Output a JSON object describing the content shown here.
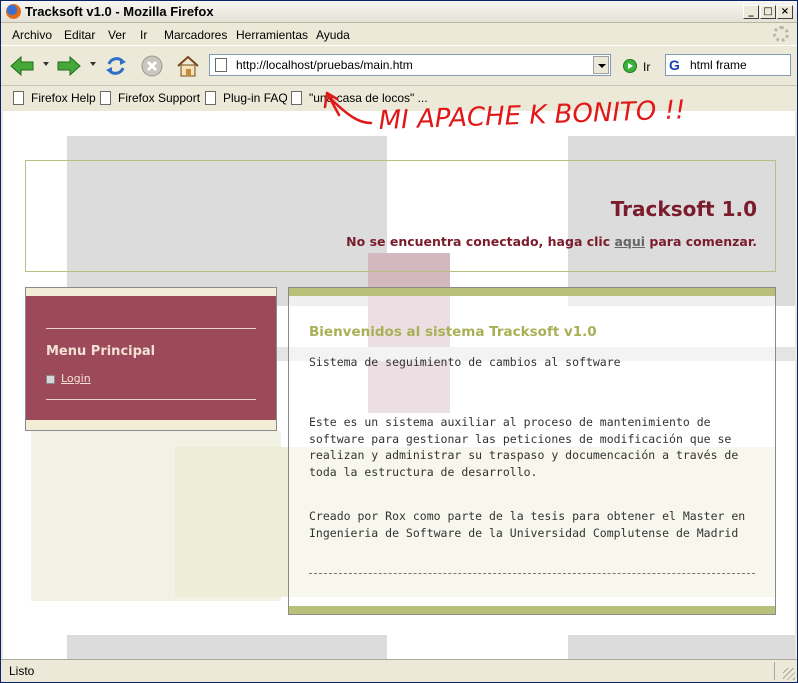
{
  "window": {
    "title": "Tracksoft v1.0 - Mozilla Firefox"
  },
  "menu": [
    "Archivo",
    "Editar",
    "Ver",
    "Ir",
    "Marcadores",
    "Herramientas",
    "Ayuda"
  ],
  "nav": {
    "url": "http://localhost/pruebas/main.htm",
    "go_label": "Ir",
    "search_value": "html frame"
  },
  "bookmarks": [
    "Firefox Help",
    "Firefox Support",
    "Plug-in FAQ",
    "\"una casa de locos\" ..."
  ],
  "header": {
    "title": "Tracksoft 1.0",
    "connect_prefix": "No se encuentra conectado, haga clic ",
    "connect_link": "aqui",
    "connect_suffix": " para comenzar."
  },
  "sidebar": {
    "title": "Menu Principal",
    "login_label": "Login"
  },
  "main": {
    "welcome": "Bienvenidos al sistema Tracksoft v1.0",
    "subtitle": "Sistema de seguimiento de cambios al software",
    "description": "Este es un sistema auxiliar al proceso de mantenimiento de software para gestionar las peticiones de modificación que se realizan y administrar su traspaso y documencación a través de toda la estructura de desarrollo.",
    "credits": "Creado por Rox como parte de la tesis para obtener el Master en Ingenieria de Software de la Universidad Complutense de Madrid"
  },
  "annotation": {
    "text": "MI APACHE K BONITO !!",
    "color": "#e01818"
  },
  "status": {
    "text": "Listo"
  },
  "colors": {
    "accent": "#7a1c2c",
    "sidebar": "#9c4a5a",
    "green": "#b9c07a"
  }
}
